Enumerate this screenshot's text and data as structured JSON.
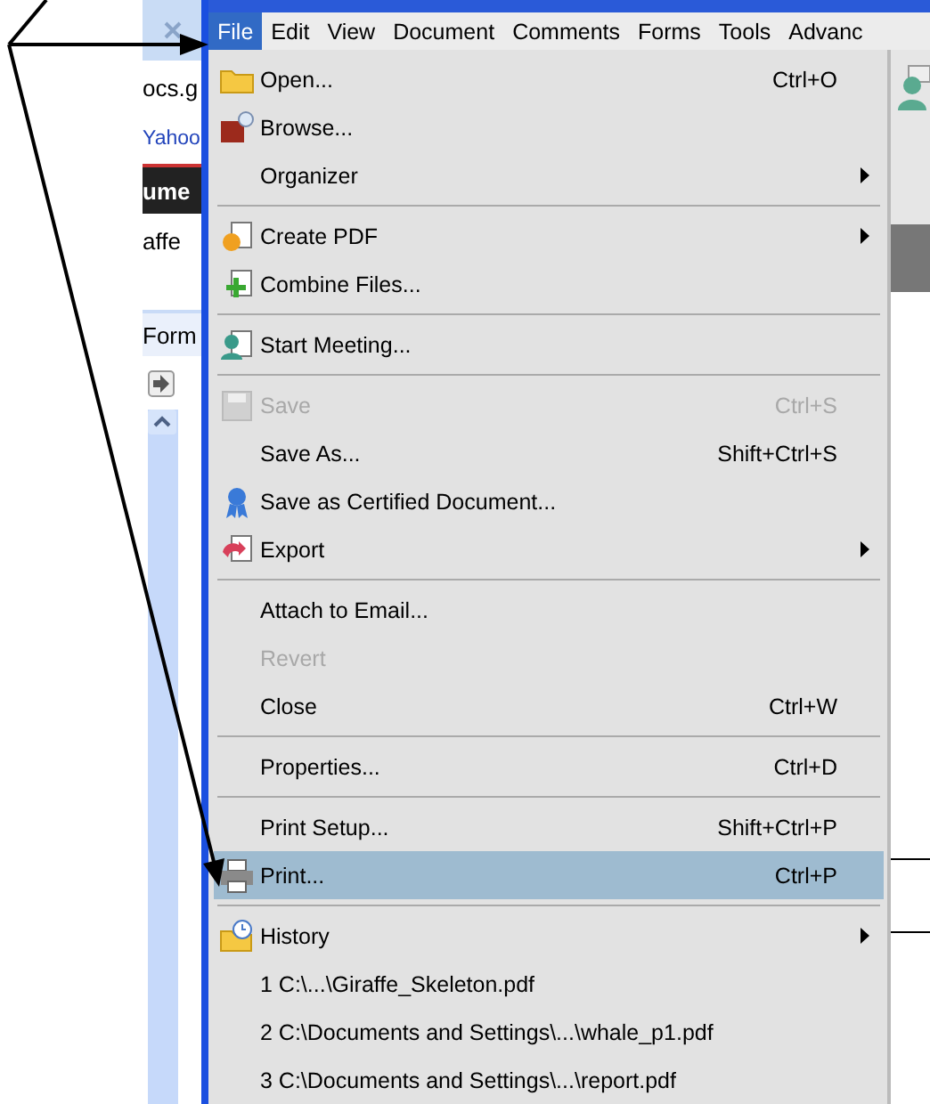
{
  "browser": {
    "fragments": [
      {
        "kind": "tab"
      },
      {
        "kind": "text",
        "text": "ocs.g"
      },
      {
        "kind": "link",
        "text": "Yahoo"
      },
      {
        "kind": "dark",
        "text": "ume"
      },
      {
        "kind": "text",
        "text": "affe"
      },
      {
        "kind": "band",
        "text": "Form"
      }
    ]
  },
  "menubar": [
    {
      "label": "File",
      "selected": true
    },
    {
      "label": "Edit",
      "selected": false
    },
    {
      "label": "View",
      "selected": false
    },
    {
      "label": "Document",
      "selected": false
    },
    {
      "label": "Comments",
      "selected": false
    },
    {
      "label": "Forms",
      "selected": false
    },
    {
      "label": "Tools",
      "selected": false
    },
    {
      "label": "Advanc",
      "selected": false
    }
  ],
  "file_menu": {
    "items": [
      {
        "kind": "item",
        "label": "Open...",
        "shortcut": "Ctrl+O",
        "disabled": false,
        "selected": false,
        "submenu": false
      },
      {
        "kind": "item",
        "label": "Browse...",
        "disabled": false,
        "selected": false,
        "submenu": false
      },
      {
        "kind": "item",
        "label": "Organizer",
        "disabled": false,
        "selected": false,
        "submenu": true
      },
      {
        "kind": "separator"
      },
      {
        "kind": "item",
        "label": "Create PDF",
        "disabled": false,
        "selected": false,
        "submenu": true
      },
      {
        "kind": "item",
        "label": "Combine Files...",
        "disabled": false,
        "selected": false,
        "submenu": false
      },
      {
        "kind": "separator"
      },
      {
        "kind": "item",
        "label": "Start Meeting...",
        "disabled": false,
        "selected": false,
        "submenu": false
      },
      {
        "kind": "separator"
      },
      {
        "kind": "item",
        "label": "Save",
        "shortcut": "Ctrl+S",
        "disabled": true,
        "selected": false,
        "submenu": false
      },
      {
        "kind": "item",
        "label": "Save As...",
        "shortcut": "Shift+Ctrl+S",
        "disabled": false,
        "selected": false,
        "submenu": false
      },
      {
        "kind": "item",
        "label": "Save as Certified Document...",
        "disabled": false,
        "selected": false,
        "submenu": false
      },
      {
        "kind": "item",
        "label": "Export",
        "disabled": false,
        "selected": false,
        "submenu": true
      },
      {
        "kind": "separator"
      },
      {
        "kind": "item",
        "label": "Attach to Email...",
        "disabled": false,
        "selected": false,
        "submenu": false
      },
      {
        "kind": "item",
        "label": "Revert",
        "disabled": true,
        "selected": false,
        "submenu": false
      },
      {
        "kind": "item",
        "label": "Close",
        "shortcut": "Ctrl+W",
        "disabled": false,
        "selected": false,
        "submenu": false
      },
      {
        "kind": "separator"
      },
      {
        "kind": "item",
        "label": "Properties...",
        "shortcut": "Ctrl+D",
        "disabled": false,
        "selected": false,
        "submenu": false
      },
      {
        "kind": "separator"
      },
      {
        "kind": "item",
        "label": "Print Setup...",
        "shortcut": "Shift+Ctrl+P",
        "disabled": false,
        "selected": false,
        "submenu": false
      },
      {
        "kind": "item",
        "label": "Print...",
        "shortcut": "Ctrl+P",
        "disabled": false,
        "selected": true,
        "submenu": false
      },
      {
        "kind": "separator"
      },
      {
        "kind": "item",
        "label": "History",
        "disabled": false,
        "selected": false,
        "submenu": true
      },
      {
        "kind": "item",
        "label": "1 C:\\...\\Giraffe_Skeleton.pdf",
        "disabled": false,
        "selected": false,
        "submenu": false
      },
      {
        "kind": "item",
        "label": "2 C:\\Documents and Settings\\...\\whale_p1.pdf",
        "disabled": false,
        "selected": false,
        "submenu": false
      },
      {
        "kind": "item",
        "label": "3 C:\\Documents and Settings\\...\\report.pdf",
        "disabled": false,
        "selected": false,
        "submenu": false
      }
    ]
  }
}
